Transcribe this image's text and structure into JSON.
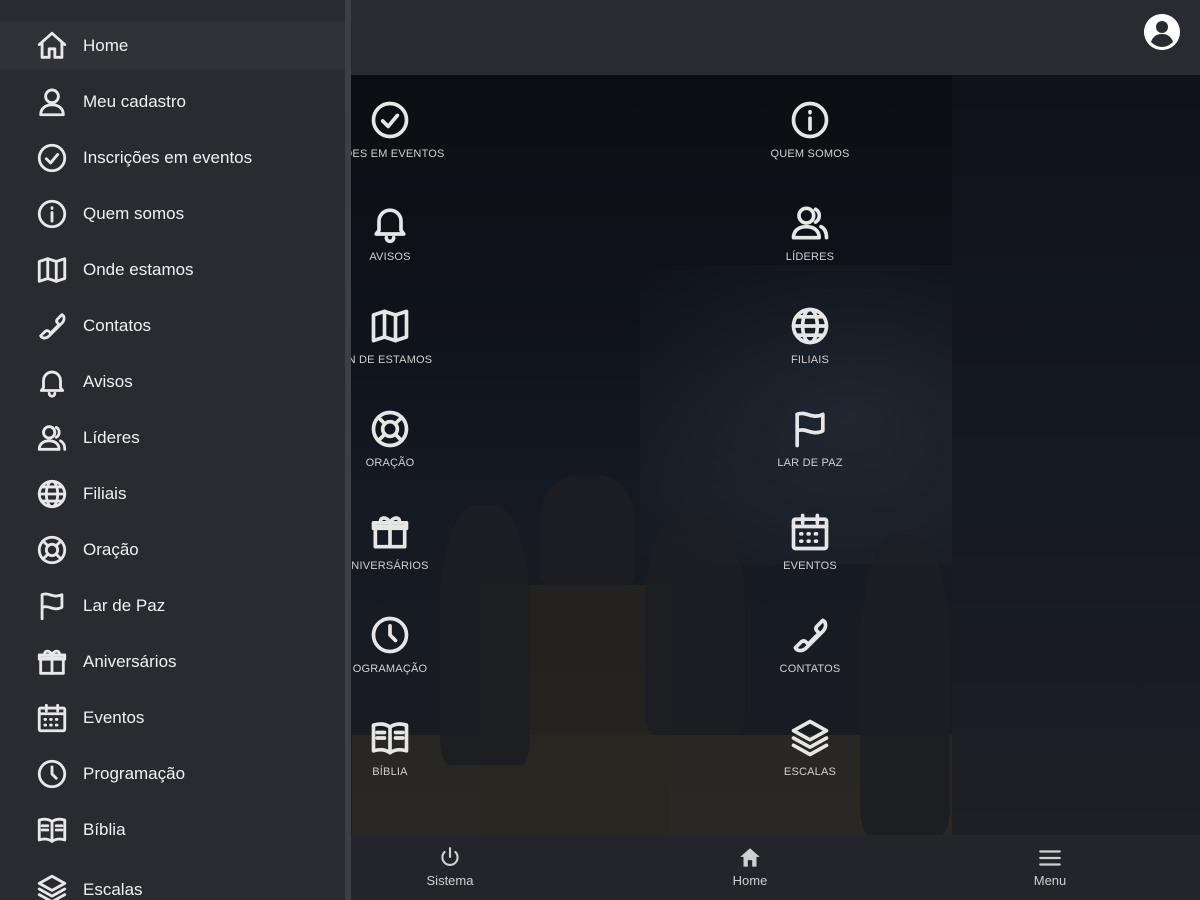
{
  "drawer": {
    "items": [
      {
        "label": "Home",
        "icon": "home-icon"
      },
      {
        "label": "Meu cadastro",
        "icon": "user-icon"
      },
      {
        "label": "Inscrições em eventos",
        "icon": "check-circle-icon"
      },
      {
        "label": "Quem somos",
        "icon": "info-icon"
      },
      {
        "label": "Onde estamos",
        "icon": "map-icon"
      },
      {
        "label": "Contatos",
        "icon": "phone-icon"
      },
      {
        "label": "Avisos",
        "icon": "bell-icon"
      },
      {
        "label": "Líderes",
        "icon": "users-icon"
      },
      {
        "label": "Filiais",
        "icon": "globe-icon"
      },
      {
        "label": "Oração",
        "icon": "lifebuoy-icon"
      },
      {
        "label": "Lar de Paz",
        "icon": "flag-icon"
      },
      {
        "label": "Aniversários",
        "icon": "gift-icon"
      },
      {
        "label": "Eventos",
        "icon": "calendar-icon"
      },
      {
        "label": "Programação",
        "icon": "clock-icon"
      },
      {
        "label": "Bíblia",
        "icon": "book-icon"
      },
      {
        "label": "Escalas",
        "icon": "layers-icon"
      }
    ]
  },
  "grid": {
    "left": [
      {
        "label": "ÇÕES EM EVENTOS",
        "icon": "check-circle-icon"
      },
      {
        "label": "AVISOS",
        "icon": "bell-icon"
      },
      {
        "label": "N DE ESTAMOS",
        "icon": "map-icon"
      },
      {
        "label": "ORAÇÃO",
        "icon": "lifebuoy-icon"
      },
      {
        "label": "NIVERSÁRIOS",
        "icon": "gift-icon"
      },
      {
        "label": "OGRAMAÇÃO",
        "icon": "clock-icon"
      },
      {
        "label": "BÍBLIA",
        "icon": "book-icon"
      }
    ],
    "right": [
      {
        "label": "QUEM SOMOS",
        "icon": "info-icon"
      },
      {
        "label": "LÍDERES",
        "icon": "users-icon"
      },
      {
        "label": "FILIAIS",
        "icon": "globe-icon"
      },
      {
        "label": "LAR DE PAZ",
        "icon": "flag-icon"
      },
      {
        "label": "EVENTOS",
        "icon": "calendar-icon"
      },
      {
        "label": "CONTATOS",
        "icon": "phone-icon"
      },
      {
        "label": "ESCALAS",
        "icon": "layers-icon"
      }
    ]
  },
  "bottom_bar": {
    "sistema": "Sistema",
    "home": "Home",
    "menu": "Menu"
  },
  "colors": {
    "drawer_bg": "#2a2b31",
    "header_bg": "#2a2b31",
    "bottom_bar_bg": "#23252b",
    "text": "#f0f0f2"
  }
}
